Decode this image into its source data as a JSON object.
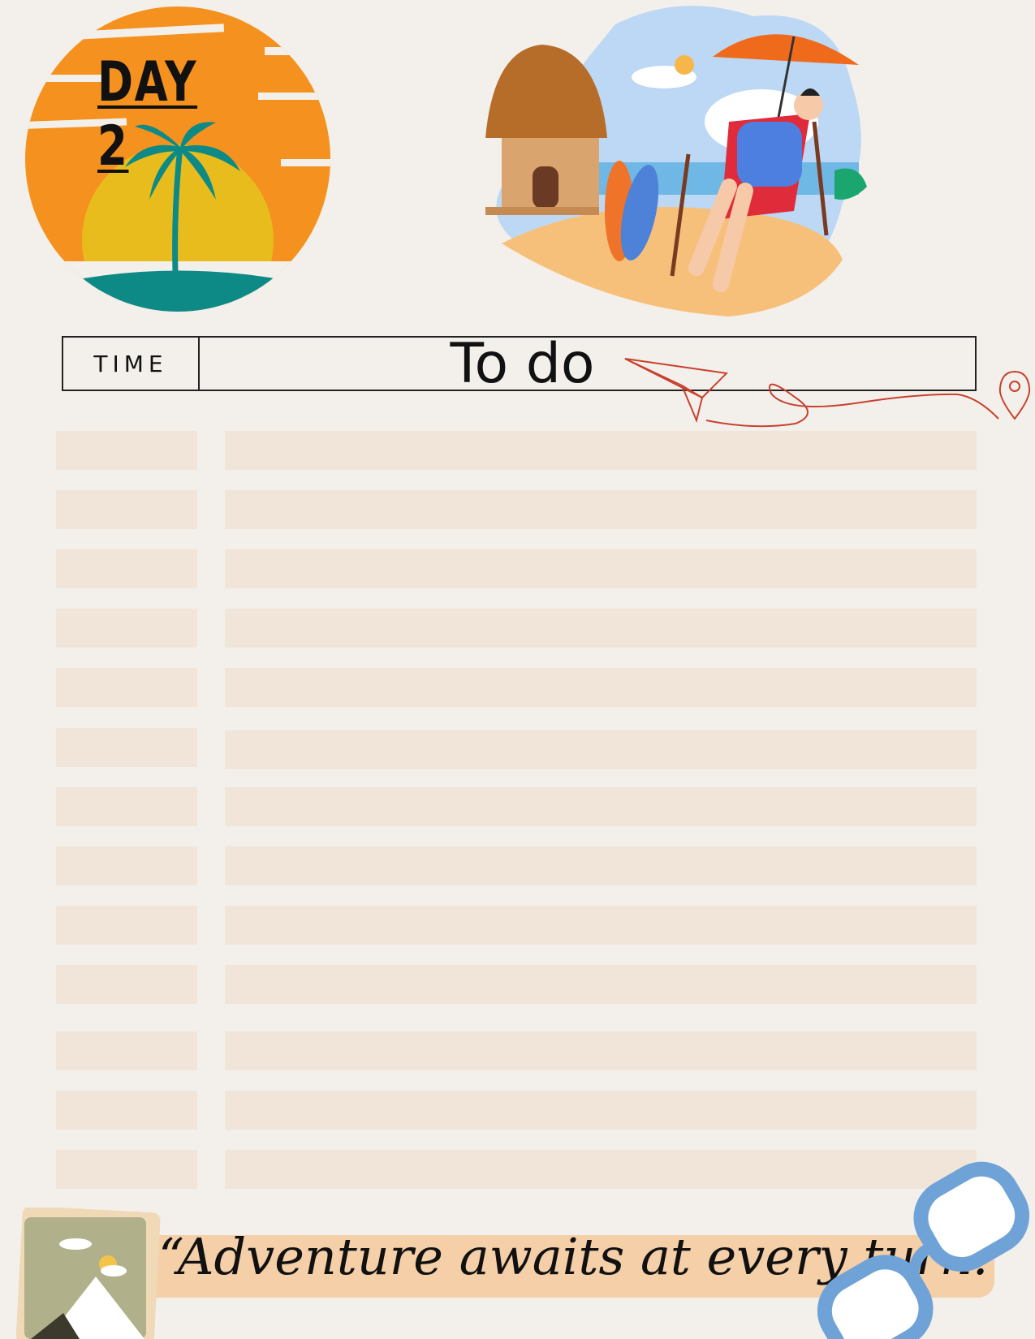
{
  "page": {
    "title": "DAY 2",
    "time_header": "TIME",
    "todo_header": "To do",
    "quote": "“Adventure awaits at every turn.”"
  },
  "colors": {
    "background": "#f3f0eb",
    "row_fill": "#f1e4d8",
    "sun_orange": "#f5911e",
    "sun_yellow": "#e8bc1c",
    "sea_teal": "#0e8a86",
    "quote_band": "#f4cfa8",
    "accent_red": "#c8412e"
  },
  "icons": [
    "palm-tree-sunset-badge",
    "beach-hut-illustration",
    "person-deckchair-illustration",
    "paper-plane-icon",
    "map-pin-icon",
    "mountain-photo-card",
    "sunglasses-icon"
  ],
  "rows": 13
}
